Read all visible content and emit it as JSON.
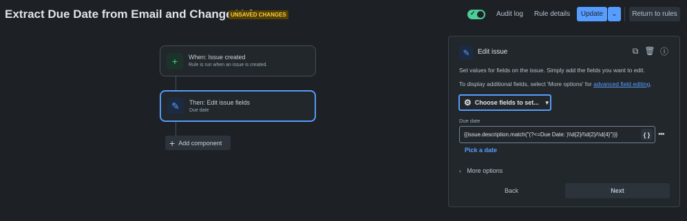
{
  "header": {
    "title": "Extract Due Date from Email and Change Value",
    "badge": "UNSAVED CHANGES",
    "audit_log": "Audit log",
    "rule_details": "Rule details",
    "update": "Update",
    "return_to_rules": "Return to rules",
    "toggle_on": true
  },
  "flow": {
    "trigger": {
      "title": "When: Issue created",
      "subtitle": "Rule is run when an issue is created."
    },
    "action": {
      "title": "Then: Edit issue fields",
      "subtitle": "Due date"
    },
    "add_component": "Add component"
  },
  "panel": {
    "title": "Edit issue",
    "description": "Set values for fields on the issue. Simply add the fields you want to edit.",
    "more_text_prefix": "To display additional fields, select 'More options' for",
    "more_text_link": "advanced field editing",
    "more_text_suffix": ".",
    "choose_fields": "Choose fields to set...",
    "field_label": "Due date",
    "field_value": "{{issue.description.match(\"(?<=Due Date: )\\\\d{2}/\\\\d{2}/\\\\d{4}\")}}",
    "brace_button": "{ }",
    "pick_date": "Pick a date",
    "more_options": "More options",
    "back": "Back",
    "next": "Next"
  },
  "colors": {
    "background": "#1d2125",
    "accent": "#579dff",
    "success": "#4bce97",
    "warning_badge_bg": "#533f04",
    "warning_badge_fg": "#f5cd47"
  }
}
